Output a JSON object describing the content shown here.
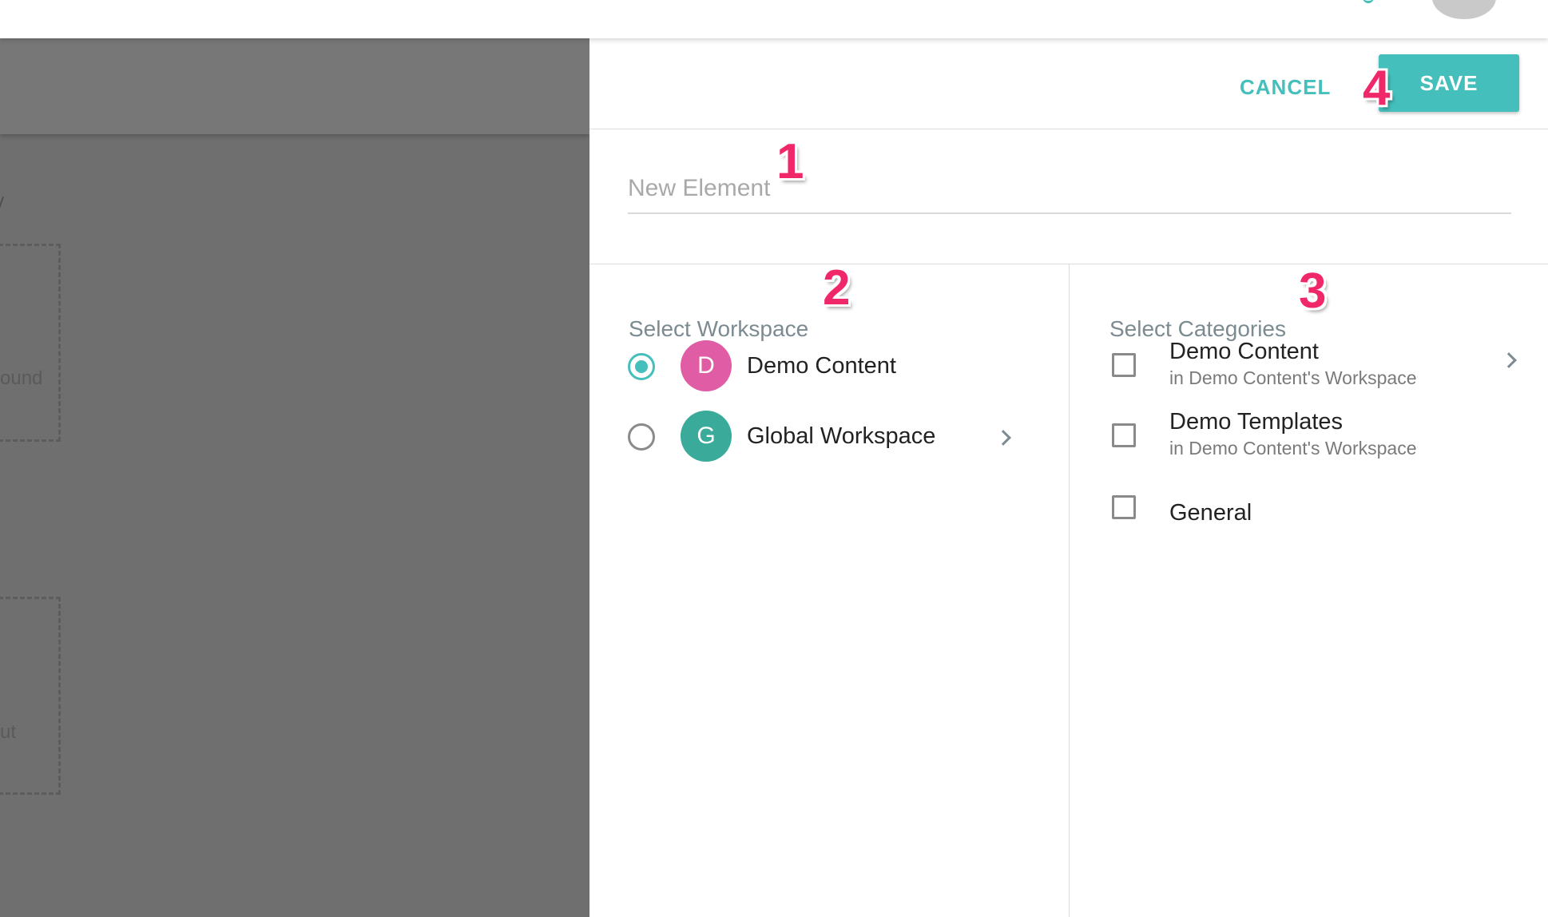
{
  "overlay": {
    "text_1": "ound",
    "text_2": "ut"
  },
  "toolbar": {
    "cancel_label": "CANCEL",
    "save_label": "SAVE"
  },
  "element_name": {
    "value": "",
    "placeholder": "New Element"
  },
  "workspace": {
    "title": "Select Workspace",
    "items": [
      {
        "label": "Demo Content",
        "initial": "D",
        "color": "#e05ca4",
        "selected": true,
        "has_children": false
      },
      {
        "label": "Global Workspace",
        "initial": "G",
        "color": "#3aab9a",
        "selected": false,
        "has_children": true
      }
    ]
  },
  "categories": {
    "title": "Select Categories",
    "items": [
      {
        "label": "Demo Content",
        "subtitle": "in Demo Content's Workspace",
        "checked": false,
        "has_children": true
      },
      {
        "label": "Demo Templates",
        "subtitle": "in Demo Content's Workspace",
        "checked": false,
        "has_children": false
      },
      {
        "label": "General",
        "subtitle": "",
        "checked": false,
        "has_children": false
      }
    ]
  },
  "step_markers": [
    "1",
    "2",
    "3",
    "4"
  ],
  "colors": {
    "accent": "#45bfbb",
    "marker": "#f0286a"
  }
}
